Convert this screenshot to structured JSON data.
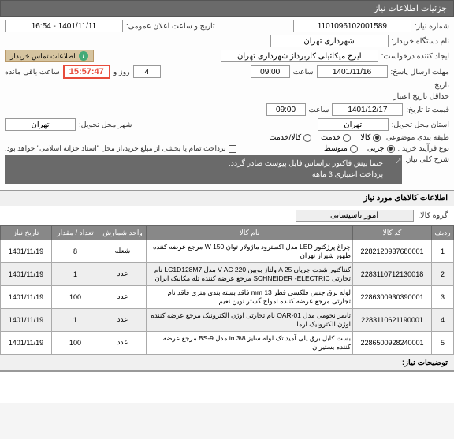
{
  "header": {
    "title": "جزئیات اطلاعات نیاز"
  },
  "form": {
    "need_no_label": "شماره نیاز:",
    "need_no": "1101096102001589",
    "announce_label": "تاریخ و ساعت اعلان عمومی:",
    "announce": "1401/11/11 - 16:54",
    "buyer_org_label": "نام دستگاه خریدار:",
    "buyer_org": "شهرداری تهران",
    "requester_label": "ایجاد کننده درخواست:",
    "requester": "ایرج میکائیلی کاربرداز شهرداری تهران",
    "contact_label": "اطلاعات تماس خریدار",
    "deadline_label": "مهلت ارسال پاسخ:",
    "deadline_date": "1401/11/16",
    "time_label": "ساعت",
    "deadline_time": "09:00",
    "days_label": "روز و",
    "days": "4",
    "remain_label": "ساعت باقی مانده",
    "remain_time": "15:57:47",
    "date_label": "تاریخ:",
    "valid_from_label": "حداقل تاریخ اعتبار",
    "valid_to_label": "قیمت تا تاریخ:",
    "valid_date": "1401/12/17",
    "valid_time": "09:00",
    "province_label": "استان محل تحویل:",
    "province": "تهران",
    "city_label": "شهر محل تحویل:",
    "city": "تهران",
    "category_label": "طبقه بندی موضوعی:",
    "cat_goods": "کالا",
    "cat_service": "خدمت",
    "cat_both": "کالا/خدمت",
    "process_label": "نوع فرآیند خرید :",
    "proc_small": "جزیی",
    "proc_medium": "متوسط",
    "proc_note": "پرداخت تمام یا بخشی از مبلغ خرید،از محل \"اسناد خزانه اسلامی\" خواهد بود.",
    "desc_label": "شرح کلی نیاز:",
    "desc_line1": "حتما  پیش فاکتور براساس فایل پیوست صادر گردد.",
    "desc_line2": "پرداخت اعتباری 3 ماهه"
  },
  "items_section": {
    "title": "اطلاعات کالاهای مورد نیاز",
    "group_label": "گروه کالا:",
    "group_value": "امور تاسیساتی"
  },
  "table": {
    "headers": {
      "row": "ردیف",
      "code": "کد کالا",
      "name": "نام کالا",
      "unit": "واحد شمارش",
      "qty": "تعداد / مقدار",
      "date": "تاریخ نیاز"
    },
    "rows": [
      {
        "n": "1",
        "code": "2282120937680001",
        "name": "چراغ پرژکتور LED مدل اکسترود ماژولار توان W 150 مرجع عرضه کننده ظهور شیراز تهران",
        "unit": "شعله",
        "qty": "8",
        "date": "1401/11/19"
      },
      {
        "n": "2",
        "code": "2283110712130018",
        "name": "کنتاکتور شدت جریان A 25 ولتاژ بوبین V AC 220 مدل LC1D128M7 نام تجارتی SCHNEIDER -ELECTRIC مرجع عرضه کننده تله مکانیک ایران",
        "unit": "عدد",
        "qty": "1",
        "date": "1401/11/19"
      },
      {
        "n": "3",
        "code": "2286300930390001",
        "name": "لوله برق جنس فلکسی قطر mm 13 فاقد بسته بندی متری فاقد نام تجارتی مرجع عرضه کننده امواج گستر نوین نعیم",
        "unit": "عدد",
        "qty": "100",
        "date": "1401/11/19"
      },
      {
        "n": "4",
        "code": "2283110621190001",
        "name": "تایمر نجومی مدل OAR-01 نام تجارتی اوژن الکترونیک مرجع عرضه کننده اوژن الکترونیک ارما",
        "unit": "عدد",
        "qty": "1",
        "date": "1401/11/19"
      },
      {
        "n": "5",
        "code": "2286500928240001",
        "name": "بست کابل برق یلی آمید تک لوله سایز in 3\\8 مدل BS-9 مرجع عرضه کننده بستیران",
        "unit": "عدد",
        "qty": "100",
        "date": "1401/11/19"
      }
    ]
  },
  "notes": {
    "label": "توضیحات نیاز:"
  }
}
